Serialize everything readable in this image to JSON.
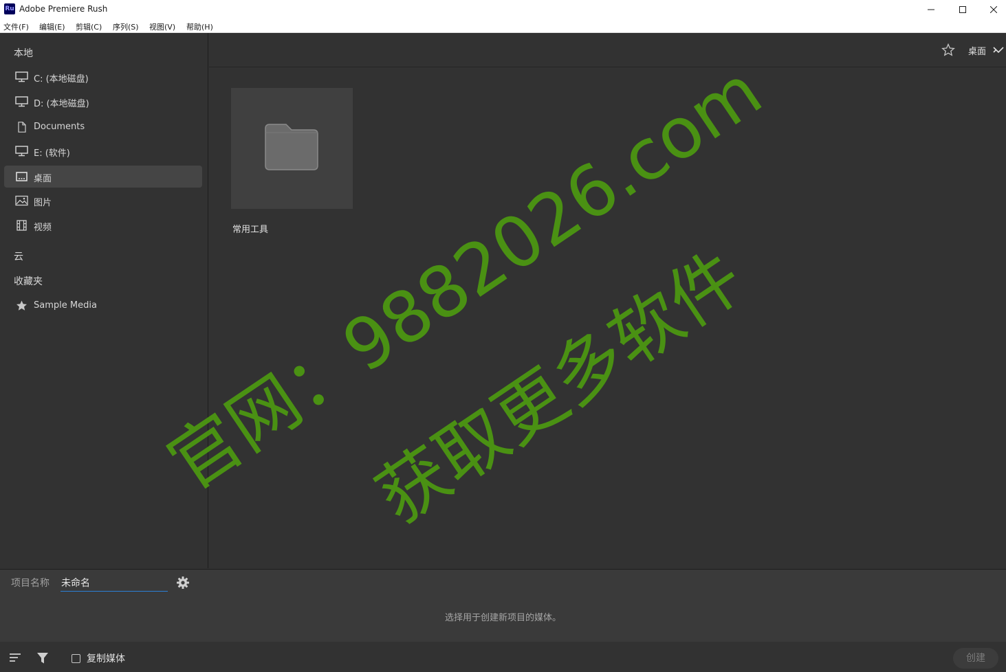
{
  "window": {
    "app_icon_text": "Ru",
    "title": "Adobe Premiere Rush"
  },
  "menu": [
    "文件(F)",
    "编辑(E)",
    "剪辑(C)",
    "序列(S)",
    "视图(V)",
    "帮助(H)"
  ],
  "sidebar": {
    "local_heading": "本地",
    "local_items": [
      {
        "label": "C: (本地磁盘)",
        "icon": "monitor-icon"
      },
      {
        "label": "D: (本地磁盘)",
        "icon": "monitor-icon"
      },
      {
        "label": "Documents",
        "icon": "document-icon"
      },
      {
        "label": "E: (软件)",
        "icon": "monitor-icon"
      },
      {
        "label": "桌面",
        "icon": "desktop-icon",
        "selected": true
      },
      {
        "label": "图片",
        "icon": "image-icon"
      },
      {
        "label": "视频",
        "icon": "film-icon"
      }
    ],
    "cloud_heading": "云",
    "favorites_heading": "收藏夹",
    "favorite_items": [
      {
        "label": "Sample Media",
        "icon": "star-icon"
      }
    ]
  },
  "browser": {
    "location": "桌面",
    "folders": [
      {
        "name": "常用工具"
      }
    ]
  },
  "watermark": {
    "line1": "官网：9882026.com",
    "line2": "获取更多软件",
    "color": "#4d9b10"
  },
  "project": {
    "name_label": "项目名称",
    "name_value": "未命名",
    "hint": "选择用于创建新项目的媒体。"
  },
  "footer": {
    "copy_media_label": "复制媒体",
    "copy_media_checked": false,
    "create_label": "创建"
  },
  "colors": {
    "accent": "#2c80d8",
    "panel_bg": "#323232",
    "selected_bg": "#454545"
  }
}
